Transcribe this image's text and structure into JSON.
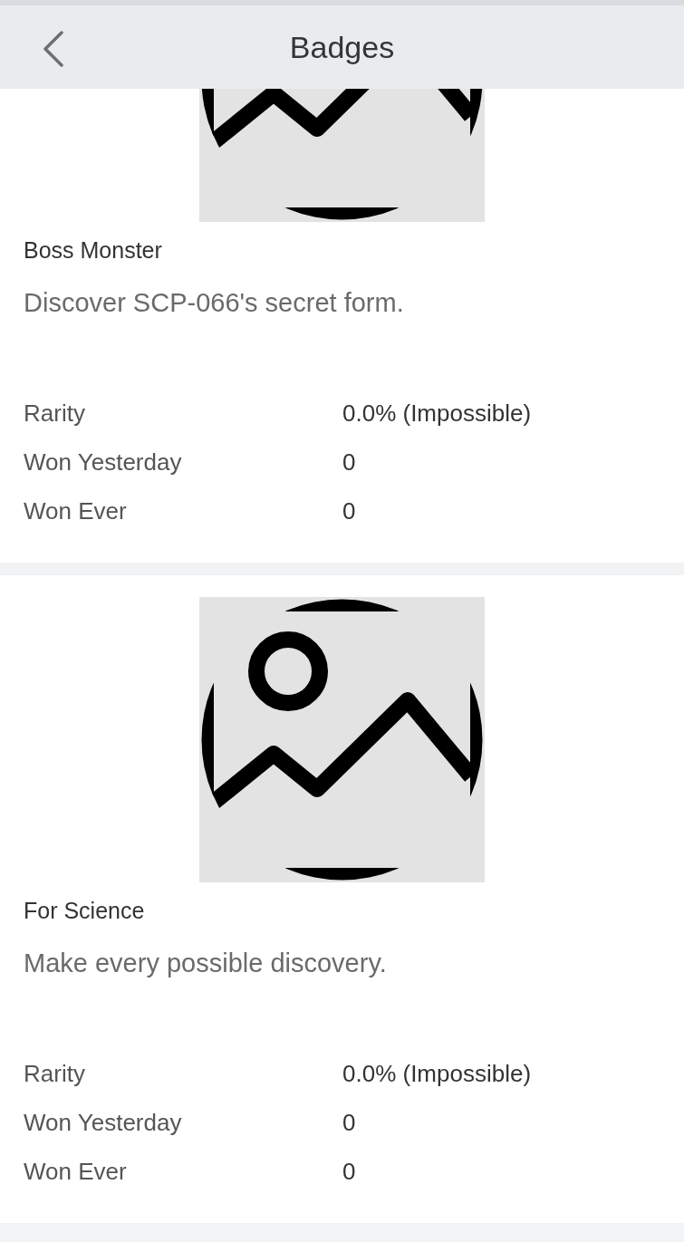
{
  "header": {
    "title": "Badges"
  },
  "badges": [
    {
      "name": "Boss Monster",
      "description": "Discover SCP-066's secret form.",
      "stats": [
        {
          "label": "Rarity",
          "value": "0.0% (Impossible)"
        },
        {
          "label": "Won Yesterday",
          "value": "0"
        },
        {
          "label": "Won Ever",
          "value": "0"
        }
      ]
    },
    {
      "name": "For Science",
      "description": "Make every possible discovery.",
      "stats": [
        {
          "label": "Rarity",
          "value": "0.0% (Impossible)"
        },
        {
          "label": "Won Yesterday",
          "value": "0"
        },
        {
          "label": "Won Ever",
          "value": "0"
        }
      ]
    }
  ]
}
